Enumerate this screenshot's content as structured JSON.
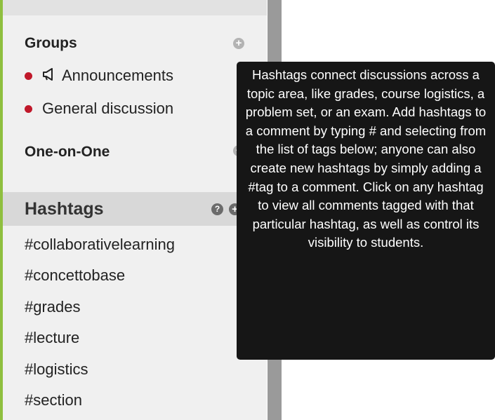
{
  "sidebar": {
    "groups": {
      "title": "Groups",
      "add_icon": "plus-circle-icon",
      "items": [
        {
          "label": "Announcements",
          "icon": "megaphone-icon",
          "status_color": "#c0182a"
        },
        {
          "label": "General discussion",
          "status_color": "#c0182a"
        }
      ]
    },
    "one_on_one": {
      "title": "One-on-One",
      "add_icon": "plus-circle-icon"
    },
    "hashtags": {
      "title": "Hashtags",
      "help_icon": "question-circle-icon",
      "add_icon": "plus-circle-icon",
      "items": [
        "#collaborativelearning",
        "#concettobase",
        "#grades",
        "#lecture",
        "#logistics",
        "#section"
      ]
    }
  },
  "tooltip": {
    "text": "Hashtags connect discussions across a topic area, like grades, course logistics, a problem set, or an exam. Add hashtags to a comment by typing # and selecting from the list of tags below; anyone can also create new hashtags by simply adding a #tag to a comment. Click on any hashtag to view all comments tagged with that particular hashtag, as well as control its visibility to students."
  },
  "colors": {
    "accent": "#8fbf3f",
    "status_dot": "#c0182a",
    "tooltip_bg": "#161616"
  }
}
